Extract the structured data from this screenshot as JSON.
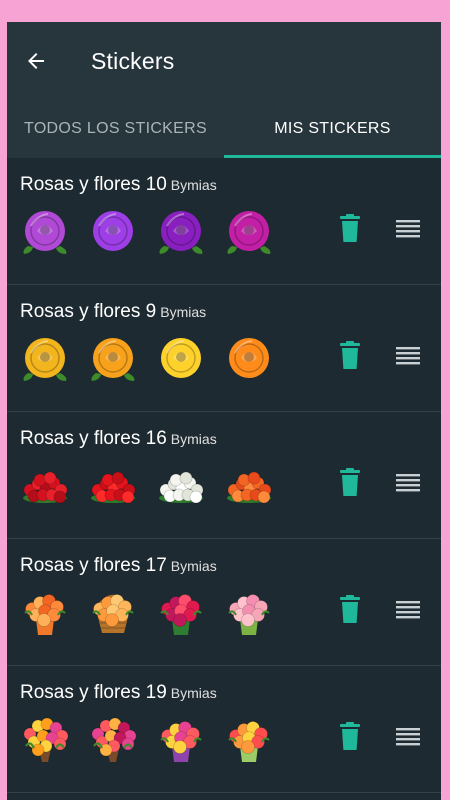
{
  "header": {
    "title": "Stickers",
    "back_icon": "arrow-back-icon"
  },
  "tabs": [
    {
      "label": "TODOS LOS STICKERS",
      "active": false
    },
    {
      "label": "MIS STICKERS",
      "active": true
    }
  ],
  "colors": {
    "accent": "#1fb89a",
    "background": "#1d2a31",
    "appbar": "#27353c",
    "frame": "#f7a3d3"
  },
  "packs": [
    {
      "name": "Rosas y flores 10",
      "author": "Bymias",
      "stickers": [
        {
          "kind": "rose",
          "color": "#b04ad6",
          "leaf": true
        },
        {
          "kind": "rose",
          "color": "#9d3ee6",
          "leaf": false
        },
        {
          "kind": "rose",
          "color": "#8a1fc0",
          "leaf": true
        },
        {
          "kind": "rose",
          "color": "#c21fa6",
          "leaf": true
        }
      ]
    },
    {
      "name": "Rosas y flores 9",
      "author": "Bymias",
      "stickers": [
        {
          "kind": "rose",
          "color": "#f3b51e",
          "leaf": true
        },
        {
          "kind": "rose",
          "color": "#f7a21a",
          "leaf": true
        },
        {
          "kind": "rose",
          "color": "#ffd22b",
          "leaf": false
        },
        {
          "kind": "rose",
          "color": "#ff8c1a",
          "leaf": false
        }
      ]
    },
    {
      "name": "Rosas y flores 16",
      "author": "Bymias",
      "stickers": [
        {
          "kind": "bunch",
          "colors": [
            "#d4121f",
            "#e8202a",
            "#b30e1a"
          ]
        },
        {
          "kind": "bunch",
          "colors": [
            "#e3141c",
            "#c90f18",
            "#ff2a2a"
          ]
        },
        {
          "kind": "bunch",
          "colors": [
            "#f5f5ef",
            "#e2e6da",
            "#ffffff"
          ]
        },
        {
          "kind": "bunch",
          "colors": [
            "#f26522",
            "#e84a1c",
            "#ff8a3c"
          ]
        }
      ]
    },
    {
      "name": "Rosas y flores 17",
      "author": "Bymias",
      "stickers": [
        {
          "kind": "vase",
          "colors": [
            "#ff8a3c",
            "#ffb15a",
            "#f26522"
          ],
          "vase": "#f07a2a"
        },
        {
          "kind": "basket",
          "colors": [
            "#ffb55a",
            "#ff9a3c",
            "#ffc873"
          ],
          "vase": "#b5732c"
        },
        {
          "kind": "vase",
          "colors": [
            "#e01a4f",
            "#c2185b",
            "#ff4d6d"
          ],
          "vase": "#2e7d32"
        },
        {
          "kind": "vase",
          "colors": [
            "#f7a6b8",
            "#ffc2cc",
            "#f48fb1"
          ],
          "vase": "#7cb342"
        }
      ]
    },
    {
      "name": "Rosas y flores 19",
      "author": "Bymias",
      "stickers": [
        {
          "kind": "bouquet",
          "colors": [
            "#ff5a5f",
            "#ffd23f",
            "#ff9f1c",
            "#e84393"
          ]
        },
        {
          "kind": "bouquet",
          "colors": [
            "#e84393",
            "#ff5a5f",
            "#ffb142",
            "#c2185b"
          ]
        },
        {
          "kind": "vase",
          "colors": [
            "#ff5a5f",
            "#ffd23f",
            "#e84393"
          ],
          "vase": "#8e44ad"
        },
        {
          "kind": "vase",
          "colors": [
            "#ff4d4d",
            "#ff9a3c",
            "#ffd23f"
          ],
          "vase": "#9ccc65"
        }
      ]
    }
  ]
}
